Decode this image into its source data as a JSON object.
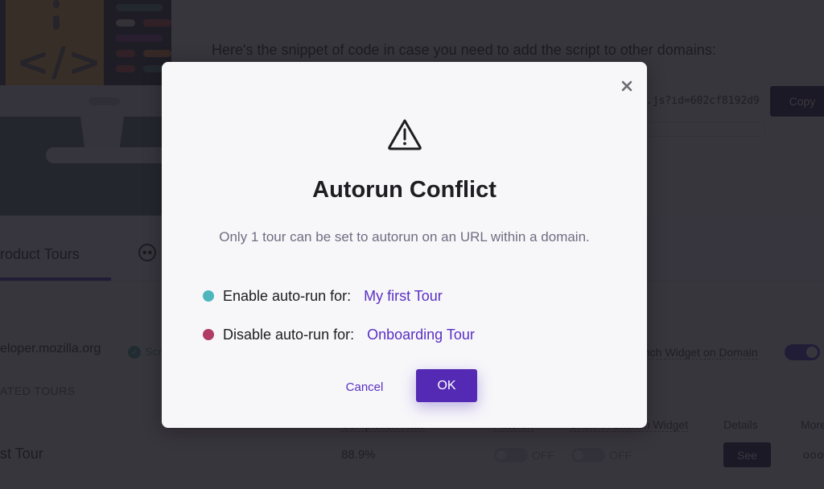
{
  "background": {
    "snippet_text": "Here's the snippet of code in case you need to add the script to other domains:",
    "snippet_code": ".js?id=602cf8192d9",
    "copy_label": "Copy",
    "tab_product_tours": "roduct Tours",
    "domain": "eloper.mozilla.org",
    "domain_status": "Scr",
    "launch_widget_label": "nch Widget on Domain",
    "section_label": "ATED TOURS",
    "columns": {
      "completion_rate": "Completion Rate",
      "autorun": "Autorun",
      "show_in_launch_widget": "Show in Launch Widget",
      "details": "Details",
      "more": "More"
    },
    "tour_row": {
      "name": "st Tour",
      "completion_rate": "88.9%",
      "autorun_state": "OFF",
      "launch_widget_state": "OFF",
      "details_label": "See",
      "more_label": "ooo"
    }
  },
  "modal": {
    "title": "Autorun Conflict",
    "description": "Only 1 tour can be set to autorun on an URL within a domain.",
    "enable_label": "Enable auto-run for:",
    "enable_tour": "My first Tour",
    "disable_label": "Disable auto-run for:",
    "disable_tour": "Onboarding Tour",
    "cancel_label": "Cancel",
    "ok_label": "OK",
    "icons": {
      "warning": "warning-triangle-icon",
      "close": "close-icon"
    }
  },
  "colors": {
    "accent": "#542ab5",
    "link": "#5a2fc2",
    "enable_dot": "#4db6bd",
    "disable_dot": "#b03c66",
    "overlay": "#1c1a22"
  }
}
